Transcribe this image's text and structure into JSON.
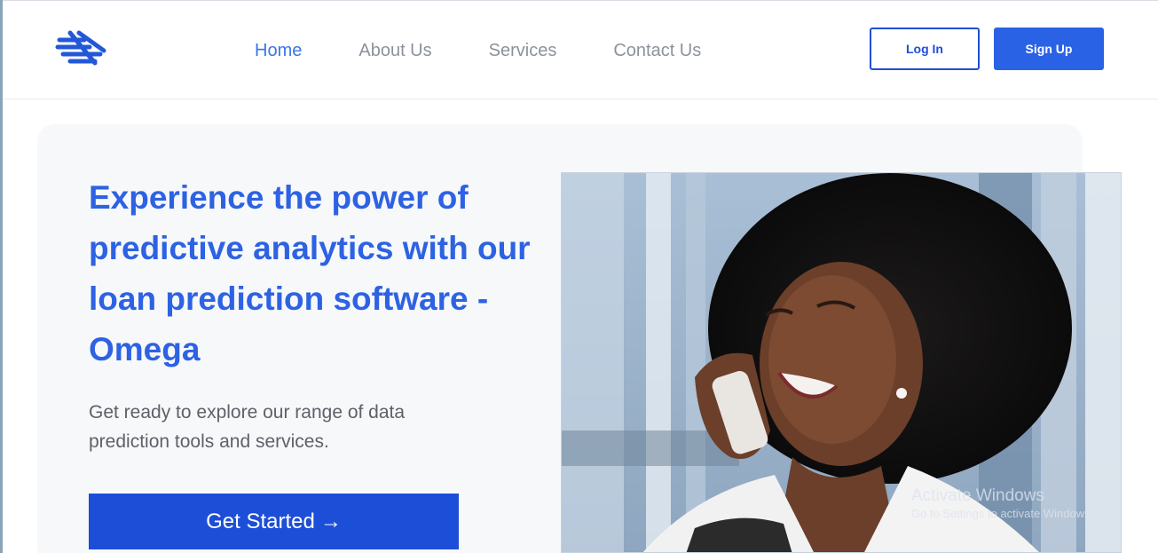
{
  "nav": {
    "items": [
      {
        "label": "Home",
        "active": true
      },
      {
        "label": "About Us",
        "active": false
      },
      {
        "label": "Services",
        "active": false
      },
      {
        "label": "Contact Us",
        "active": false
      }
    ]
  },
  "auth": {
    "login_label": "Log In",
    "signup_label": "Sign Up"
  },
  "hero": {
    "title": "Experience the power of predictive analytics with our loan prediction software - Omega",
    "subtitle": "Get ready to explore our range of data prediction tools and services.",
    "cta_label": "Get Started",
    "cta_arrow": "→"
  },
  "watermark": {
    "line1": "Activate Windows",
    "line2": "Go to Settings to activate Windows."
  },
  "colors": {
    "brand_blue": "#1d4ed8",
    "accent_blue": "#2d62e3",
    "nav_inactive": "#8c929c",
    "hero_bg": "#f7f8fa"
  },
  "icons": {
    "logo": "brand-logo-icon",
    "arrow": "arrow-right-icon"
  }
}
